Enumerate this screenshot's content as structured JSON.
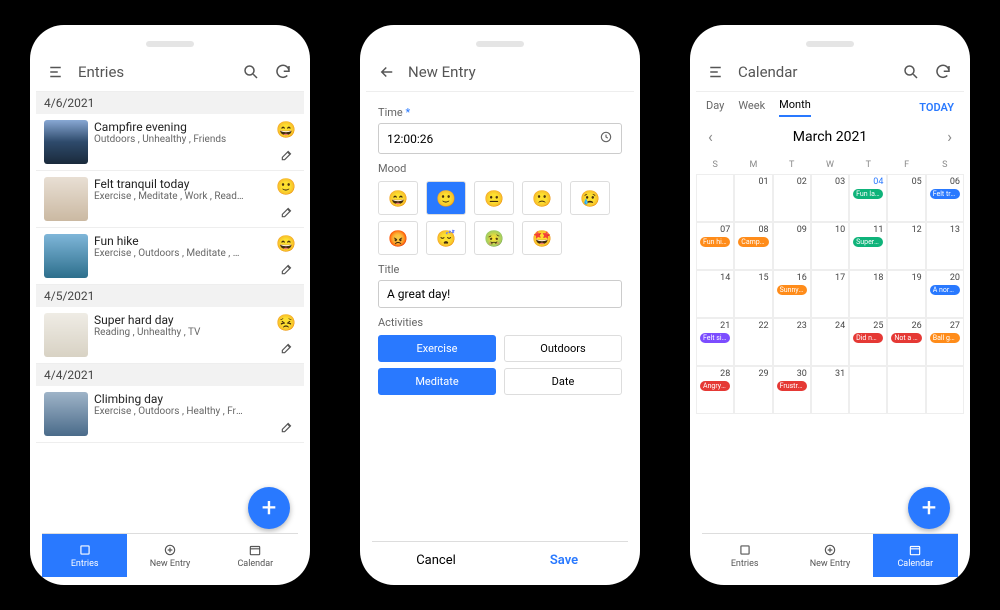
{
  "phone1": {
    "appbar_title": "Entries",
    "sections": [
      {
        "date": "4/6/2021",
        "entries": [
          {
            "title": "Campfire evening",
            "sub": "Outdoors , Unhealthy , Friends",
            "emoji": "😄",
            "thumb": "campfire"
          },
          {
            "title": "Felt tranquil today",
            "sub": "Exercise , Meditate , Work , Reading , Healt...",
            "emoji": "🙂",
            "thumb": "stones"
          },
          {
            "title": "Fun hike",
            "sub": "Exercise , Outdoors , Meditate , Date , Heal...",
            "emoji": "😄",
            "thumb": "mountains"
          }
        ]
      },
      {
        "date": "4/5/2021",
        "entries": [
          {
            "title": "Super hard day",
            "sub": "Reading , Unhealthy , TV",
            "emoji": "😣",
            "thumb": "book"
          }
        ]
      },
      {
        "date": "4/4/2021",
        "entries": [
          {
            "title": "Climbing day",
            "sub": "Exercise , Outdoors , Healthy , Fri...",
            "emoji": "",
            "thumb": "climb"
          }
        ]
      }
    ],
    "nav": {
      "entries": "Entries",
      "new": "New Entry",
      "calendar": "Calendar"
    }
  },
  "phone2": {
    "appbar_title": "New Entry",
    "time_label": "Time",
    "time_value": "12:00:26",
    "mood_label": "Mood",
    "moods1": [
      "😄",
      "🙂",
      "😐",
      "🙁",
      "😢"
    ],
    "moods2": [
      "😡",
      "😴",
      "🤢",
      "🤩"
    ],
    "mood_selected": 1,
    "title_label": "Title",
    "title_value": "A great day!",
    "activities_label": "Activities",
    "activities": [
      {
        "label": "Exercise",
        "selected": true
      },
      {
        "label": "Outdoors",
        "selected": false
      },
      {
        "label": "Meditate",
        "selected": true
      },
      {
        "label": "Date",
        "selected": false
      }
    ],
    "cancel": "Cancel",
    "save": "Save"
  },
  "phone3": {
    "appbar_title": "Calendar",
    "tabs": {
      "day": "Day",
      "week": "Week",
      "month": "Month"
    },
    "today": "TODAY",
    "month_title": "March 2021",
    "dow": [
      "S",
      "M",
      "T",
      "W",
      "T",
      "F",
      "S"
    ],
    "days": [
      {
        "n": "",
        "ev": []
      },
      {
        "n": "01",
        "ev": []
      },
      {
        "n": "02",
        "ev": []
      },
      {
        "n": "03",
        "ev": []
      },
      {
        "n": "04",
        "ev": [
          {
            "t": "Fun late n",
            "c": "#0fb37a"
          }
        ],
        "hl": true
      },
      {
        "n": "05",
        "ev": []
      },
      {
        "n": "06",
        "ev": [
          {
            "t": "Felt tranq",
            "c": "#2979ff"
          }
        ]
      },
      {
        "n": "07",
        "ev": [
          {
            "t": "Fun hike",
            "c": "#ff8c1a"
          }
        ]
      },
      {
        "n": "08",
        "ev": [
          {
            "t": "Campfire",
            "c": "#ff8c1a"
          }
        ]
      },
      {
        "n": "09",
        "ev": []
      },
      {
        "n": "10",
        "ev": []
      },
      {
        "n": "11",
        "ev": [
          {
            "t": "Super ha",
            "c": "#0fb37a"
          }
        ]
      },
      {
        "n": "12",
        "ev": []
      },
      {
        "n": "13",
        "ev": []
      },
      {
        "n": "14",
        "ev": []
      },
      {
        "n": "15",
        "ev": []
      },
      {
        "n": "16",
        "ev": [
          {
            "t": "Sunny da",
            "c": "#ff8c1a"
          }
        ]
      },
      {
        "n": "17",
        "ev": []
      },
      {
        "n": "18",
        "ev": []
      },
      {
        "n": "19",
        "ev": []
      },
      {
        "n": "20",
        "ev": [
          {
            "t": "A normal",
            "c": "#2979ff"
          }
        ]
      },
      {
        "n": "21",
        "ev": [
          {
            "t": "Felt sick",
            "c": "#7c4dff"
          }
        ]
      },
      {
        "n": "22",
        "ev": []
      },
      {
        "n": "23",
        "ev": []
      },
      {
        "n": "24",
        "ev": []
      },
      {
        "n": "25",
        "ev": [
          {
            "t": "Did not s",
            "c": "#e53935"
          }
        ]
      },
      {
        "n": "26",
        "ev": [
          {
            "t": "Not a gre",
            "c": "#e53935"
          }
        ]
      },
      {
        "n": "27",
        "ev": [
          {
            "t": "Ball gam",
            "c": "#ff8c1a"
          }
        ]
      },
      {
        "n": "28",
        "ev": [
          {
            "t": "Angry tod",
            "c": "#e53935"
          }
        ]
      },
      {
        "n": "29",
        "ev": []
      },
      {
        "n": "30",
        "ev": [
          {
            "t": "Frustratin",
            "c": "#e53935"
          }
        ]
      },
      {
        "n": "31",
        "ev": []
      },
      {
        "n": "",
        "ev": []
      },
      {
        "n": "",
        "ev": []
      },
      {
        "n": "",
        "ev": []
      }
    ],
    "nav": {
      "entries": "Entries",
      "new": "New Entry",
      "calendar": "Calendar"
    }
  },
  "thumbs": {
    "campfire": "linear-gradient(180deg,#88a8d4 0%,#2e4a6b 50%,#1a2a3b 100%)",
    "stones": "linear-gradient(180deg,#e8dfd4 0%,#cbb9a2 100%)",
    "mountains": "linear-gradient(180deg,#7fb6d9 0%,#2d6f8c 100%)",
    "book": "linear-gradient(180deg,#efece5 0%,#d8d2c4 100%)",
    "climb": "linear-gradient(180deg,#9fb4c8 0%,#4a6b8a 100%)"
  }
}
